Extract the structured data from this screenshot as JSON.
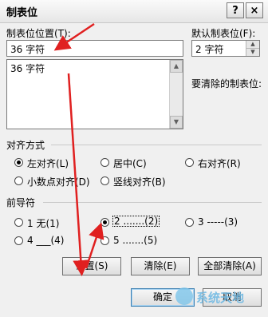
{
  "window": {
    "title": "制表位",
    "help_button": "?",
    "close_button": "×"
  },
  "tab_stop_position": {
    "label": "制表位位置(T):",
    "value": "36 字符",
    "list_items": [
      "36 字符"
    ]
  },
  "default_tab_stops": {
    "label": "默认制表位(F):",
    "value": "2 字符"
  },
  "to_clear_label": "要清除的制表位:",
  "alignment": {
    "title": "对齐方式",
    "options": [
      {
        "label": "左对齐(L)",
        "selected": true
      },
      {
        "label": "居中(C)",
        "selected": false
      },
      {
        "label": "右对齐(R)",
        "selected": false
      },
      {
        "label": "小数点对齐(D)",
        "selected": false
      },
      {
        "label": "竖线对齐(B)",
        "selected": false
      }
    ]
  },
  "leader": {
    "title": "前导符",
    "options": [
      {
        "label": "1 无(1)",
        "selected": false
      },
      {
        "label": "2 .......(2)",
        "selected": true
      },
      {
        "label": "3 -----(3)",
        "selected": false
      },
      {
        "label": "4 ___(4)",
        "selected": false
      },
      {
        "label": "5 .......(5)",
        "selected": false
      }
    ]
  },
  "buttons": {
    "set": "设置(S)",
    "clear": "清除(E)",
    "clear_all": "全部清除(A)",
    "ok": "确定",
    "cancel": "取消"
  },
  "watermark": "系统天地",
  "colors": {
    "annotation_arrow": "#e02020",
    "default_button_border": "#3c7fb1"
  }
}
